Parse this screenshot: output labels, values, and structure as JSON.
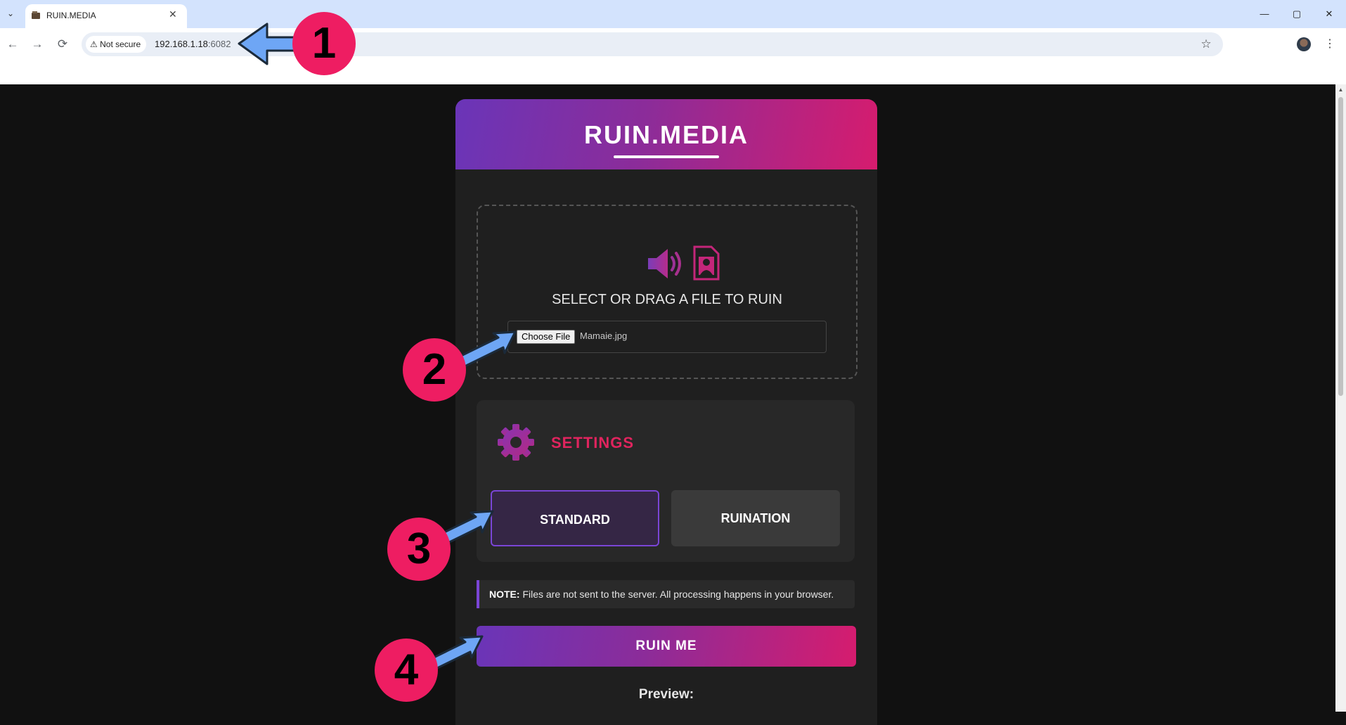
{
  "browser": {
    "tab_title": "RUIN.MEDIA",
    "tab_close": "✕",
    "security_label": "Not secure",
    "url_host": "192.168.1.18",
    "url_port": ":6082",
    "window_controls": [
      "—",
      "▢",
      "✕"
    ]
  },
  "app": {
    "title": "RUIN.MEDIA",
    "dropzone": {
      "text": "SELECT OR DRAG A FILE TO RUIN",
      "choose_button": "Choose File",
      "file_name": "Mamaie.jpg"
    },
    "settings": {
      "title": "SETTINGS",
      "modes": [
        {
          "label": "STANDARD",
          "selected": true
        },
        {
          "label": "RUINATION",
          "selected": false
        }
      ]
    },
    "note": {
      "label": "NOTE:",
      "text": " Files are not sent to the server. All processing happens in your browser."
    },
    "ruin_button": "RUIN ME",
    "preview_label": "Preview:"
  },
  "annotations": {
    "badges": [
      "1",
      "2",
      "3",
      "4"
    ]
  },
  "colors": {
    "gradient_start": "#6a35b8",
    "gradient_end": "#d61c6e",
    "accent_pink": "#e0245e",
    "accent_purple": "#7a45d6",
    "badge": "#ee1d62",
    "arrow": "#6ea6f5"
  }
}
